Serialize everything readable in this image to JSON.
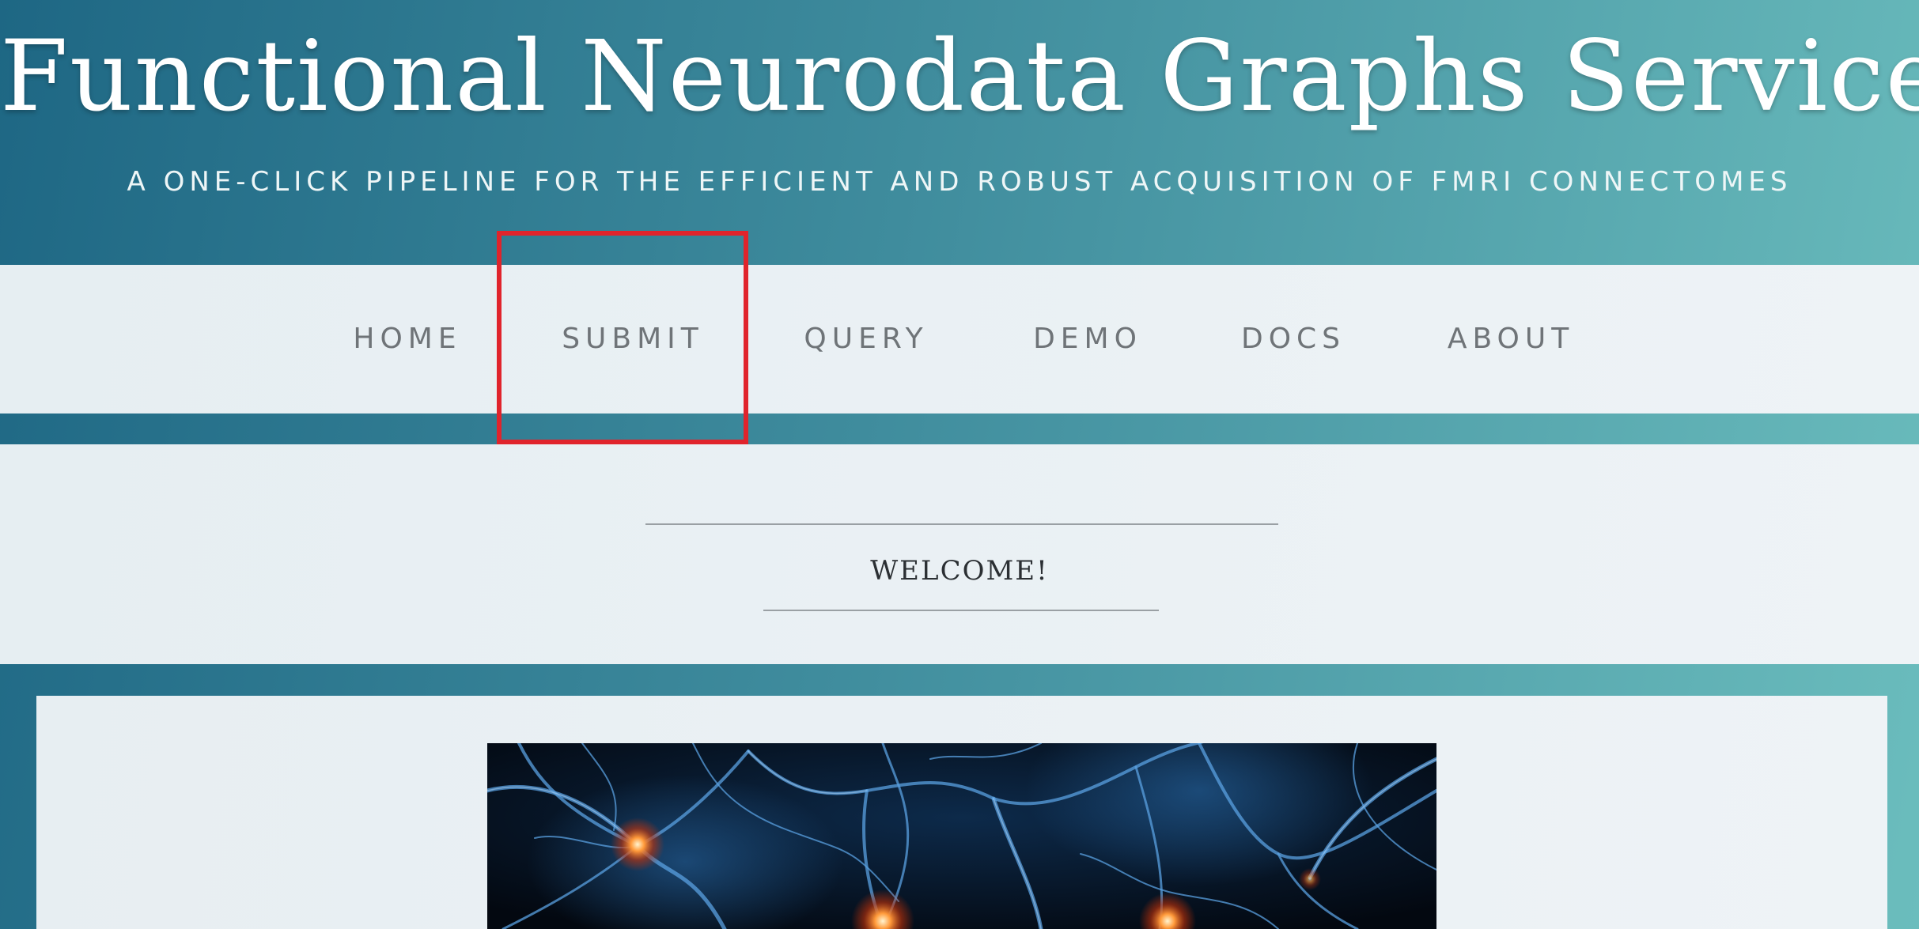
{
  "header": {
    "title": "Functional Neurodata Graphs Service",
    "subtitle": "A ONE-CLICK PIPELINE FOR THE EFFICIENT AND ROBUST ACQUISITION OF FMRI CONNECTOMES"
  },
  "nav": {
    "items": [
      {
        "label": "HOME"
      },
      {
        "label": "SUBMIT"
      },
      {
        "label": "QUERY"
      },
      {
        "label": "DEMO"
      },
      {
        "label": "DOCS"
      },
      {
        "label": "ABOUT"
      }
    ],
    "highlighted": "SUBMIT"
  },
  "welcome": {
    "heading": "WELCOME!"
  },
  "content": {
    "image": "neuron-network-image"
  },
  "colors": {
    "gradient_start": "#1e6784",
    "gradient_end": "#6bbdbd",
    "nav_background": "#eaf0f4",
    "nav_text": "#6f7478",
    "highlight": "#e0242c"
  }
}
